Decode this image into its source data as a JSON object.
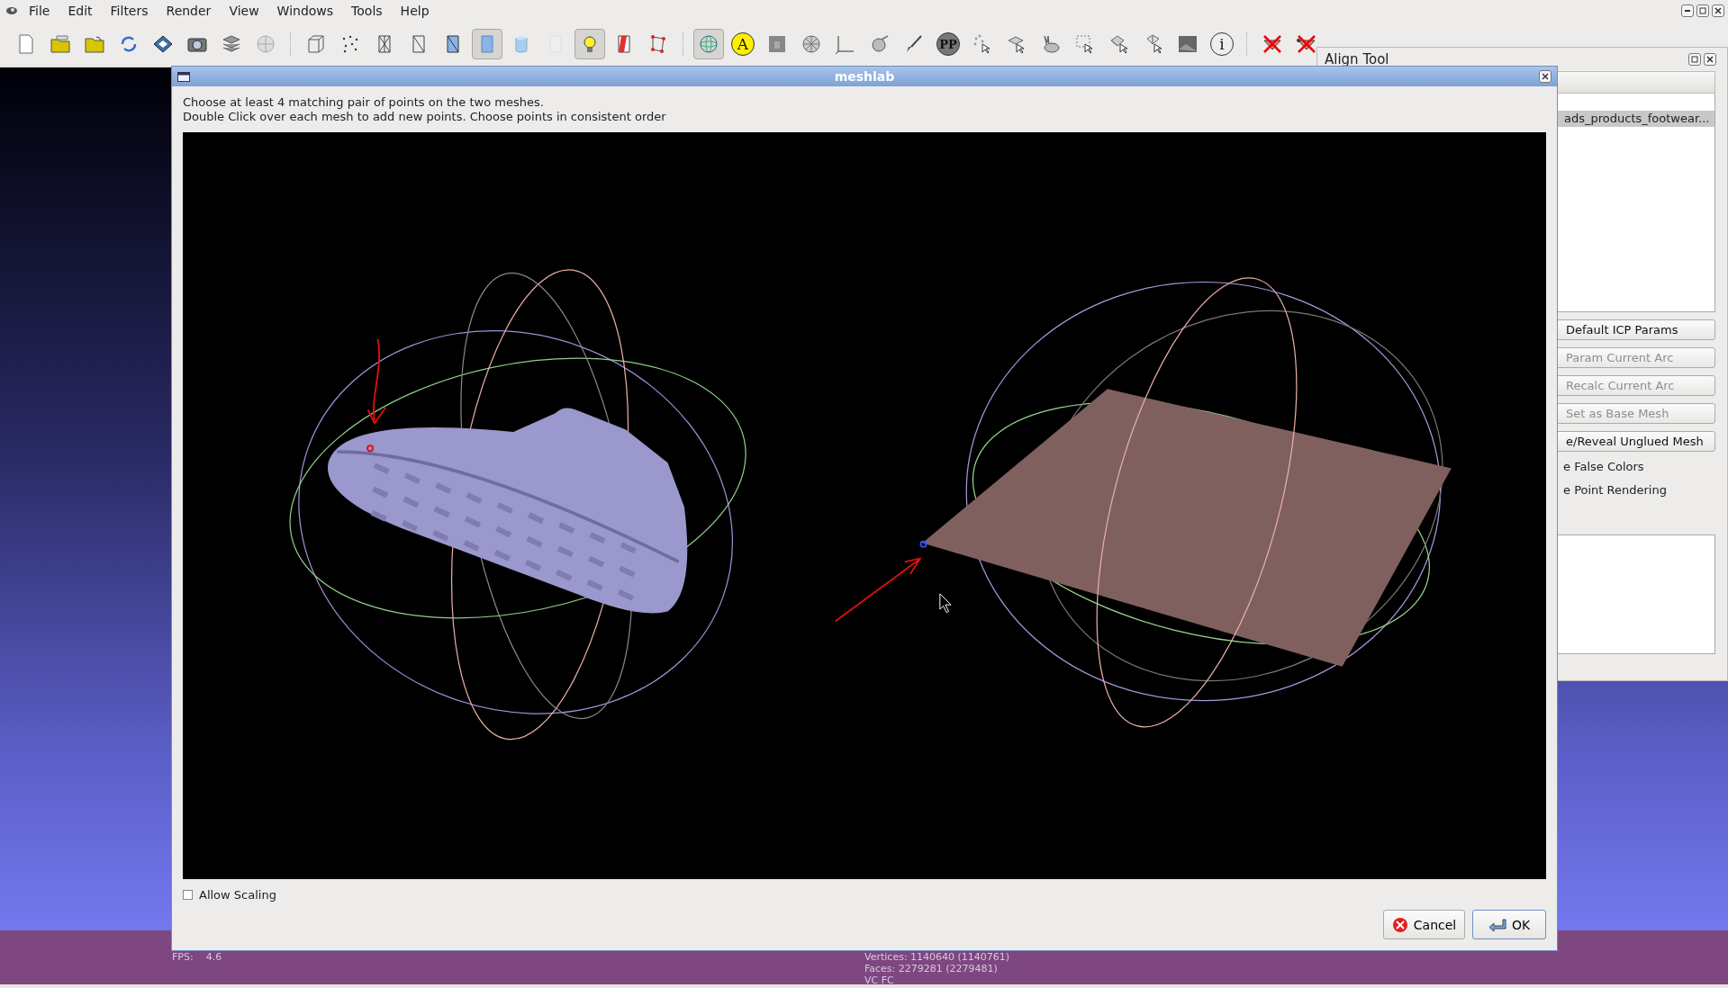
{
  "menu": [
    {
      "label": "File"
    },
    {
      "label": "Edit"
    },
    {
      "label": "Filters"
    },
    {
      "label": "Render"
    },
    {
      "label": "View"
    },
    {
      "label": "Windows"
    },
    {
      "label": "Tools"
    },
    {
      "label": "Help"
    }
  ],
  "toolbar": [
    {
      "selected": false
    },
    {
      "selected": false
    },
    {
      "selected": false
    },
    {
      "selected": false
    },
    {
      "selected": false
    },
    {
      "selected": false
    },
    {
      "selected": false
    },
    {
      "selected": false
    },
    {
      "selected": false
    },
    {
      "selected": false
    },
    {
      "selected": false
    },
    {
      "selected": false
    },
    {
      "selected": false
    },
    {
      "selected": true
    },
    {
      "selected": false
    },
    {
      "selected": false
    },
    {
      "selected": true
    },
    {
      "selected": false
    },
    {
      "selected": false
    },
    {
      "selected": true
    },
    {
      "selected": false,
      "glyph": "A"
    },
    {
      "selected": false
    },
    {
      "selected": false
    },
    {
      "selected": false
    },
    {
      "selected": false
    },
    {
      "selected": false
    },
    {
      "selected": false,
      "glyph": "PP"
    },
    {
      "selected": false
    },
    {
      "selected": false
    },
    {
      "selected": false
    },
    {
      "selected": false
    },
    {
      "selected": false
    },
    {
      "selected": false
    },
    {
      "selected": false
    },
    {
      "selected": false,
      "glyph": "i"
    },
    {
      "selected": false
    },
    {
      "selected": false
    }
  ],
  "align_tool": {
    "title": "Align Tool",
    "list_items": [
      {
        "label": "ads_products_footwear...",
        "selected": true
      }
    ],
    "buttons": [
      {
        "label": "Default ICP Params",
        "disabled": false
      },
      {
        "label": "Param Current Arc",
        "disabled": true
      },
      {
        "label": "Recalc Current Arc",
        "disabled": true
      },
      {
        "label": "Set as Base Mesh",
        "disabled": true
      },
      {
        "label": "e/Reveal Unglued Mesh",
        "disabled": false
      }
    ],
    "options": [
      "e False Colors",
      "e Point Rendering"
    ]
  },
  "dialog": {
    "title": "meshlab",
    "instructions": [
      "Choose at least 4 matching pair of points on the two meshes.",
      "Double Click over each mesh to add new points. Choose points in consistent order"
    ],
    "allow_scaling": {
      "label": "Allow Scaling",
      "checked": false
    },
    "buttons": [
      {
        "label": "Cancel",
        "kind": "cancel"
      },
      {
        "label": "OK",
        "kind": "ok"
      }
    ]
  },
  "status": {
    "fps_label": "FPS:",
    "fps": "4.6",
    "mesh_info": [
      "Vertices: 1140640 (1140761)",
      "Faces: 2279281 (2279481)",
      "VC FC"
    ]
  }
}
